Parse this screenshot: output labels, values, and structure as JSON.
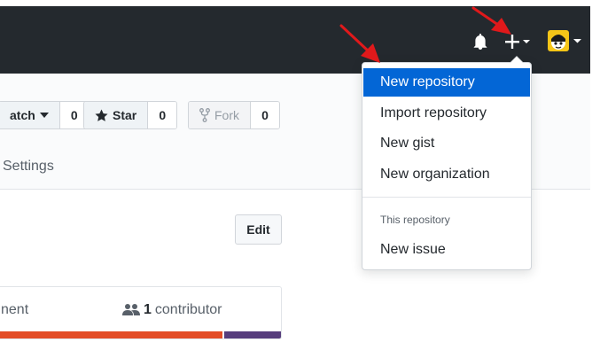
{
  "header": {
    "notifications_icon": "bell-icon",
    "create_icon": "plus-icon",
    "avatar_icon": "avatar-icon"
  },
  "repo_actions": {
    "watch": {
      "label": "atch",
      "count": "0"
    },
    "star": {
      "label": "Star",
      "count": "0"
    },
    "fork": {
      "label": "Fork",
      "count": "0"
    }
  },
  "tabs": {
    "settings": "Settings"
  },
  "edit_button": "Edit",
  "summary": {
    "left_text": "nent",
    "contributors_count": "1",
    "contributors_label": "contributor"
  },
  "dropdown": {
    "items": [
      "New repository",
      "Import repository",
      "New gist",
      "New organization"
    ],
    "section_header": "This repository",
    "section_items": [
      "New issue"
    ]
  },
  "colors": {
    "header_bg": "#24292e",
    "active_item": "#0366d6",
    "annotation_arrow": "#e0191b",
    "lang_orange": "#e34c26",
    "lang_purple": "#563d7c"
  }
}
